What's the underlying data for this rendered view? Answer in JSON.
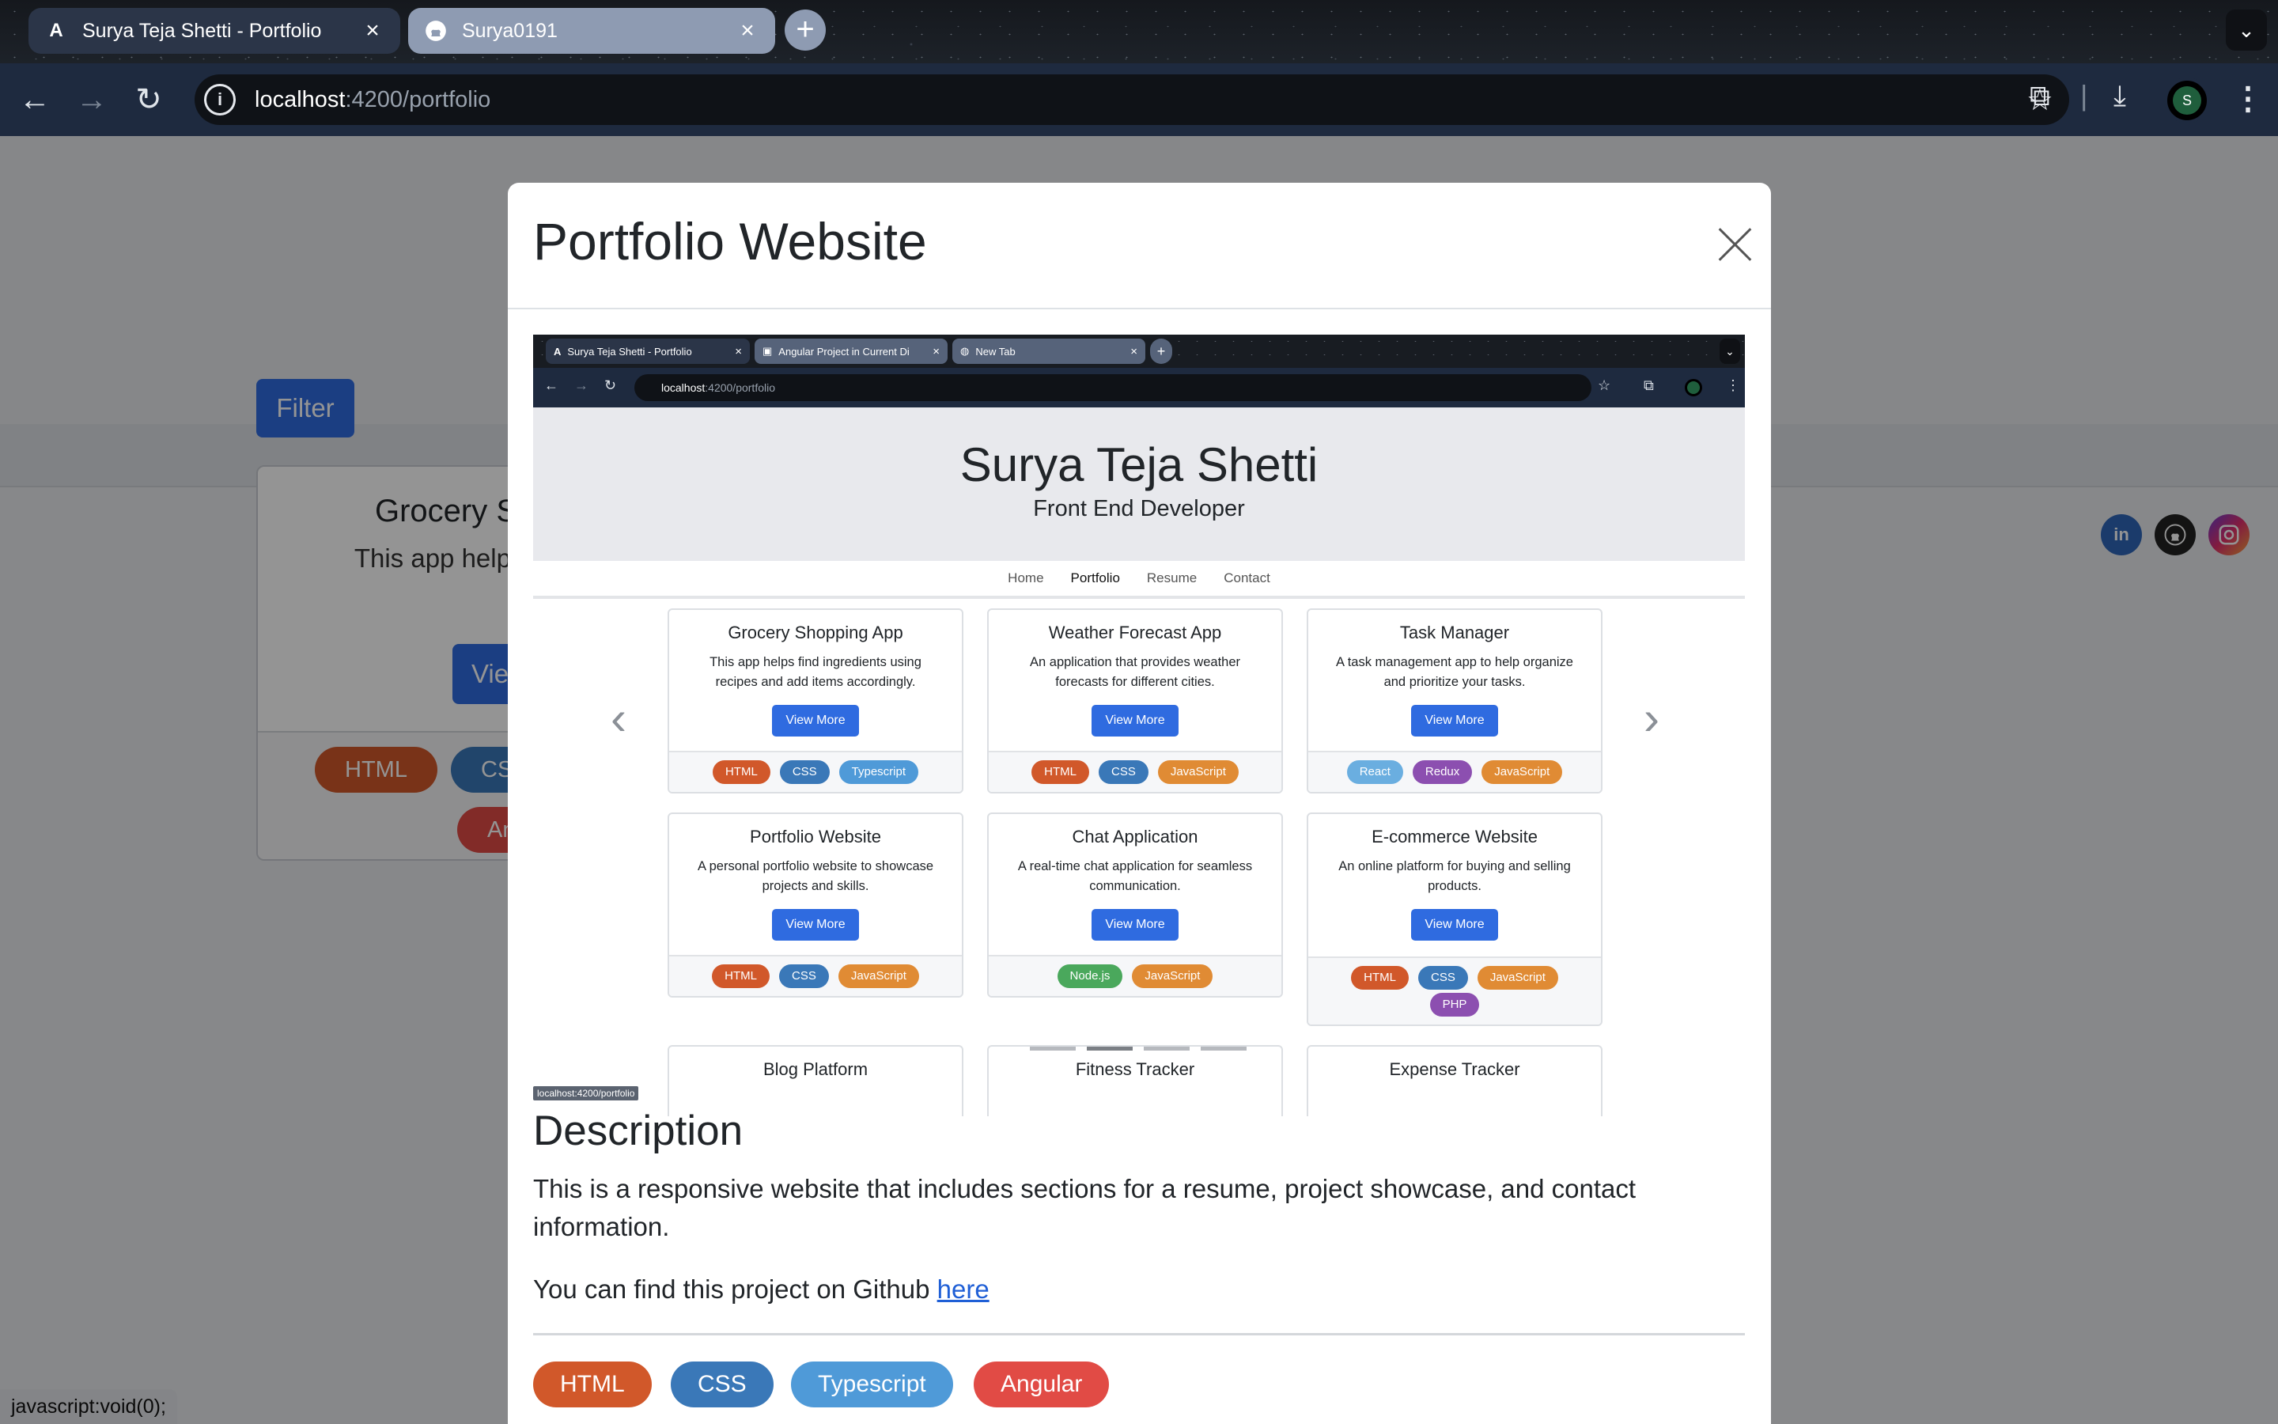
{
  "browser": {
    "tabs": [
      {
        "title": "Surya Teja Shetti - Portfolio",
        "icon": "angular-icon",
        "active": true
      },
      {
        "title": "Surya0191",
        "icon": "github-icon",
        "active": false
      }
    ],
    "new_tab": "+",
    "url_host": "localhost",
    "url_path": ":4200/portfolio",
    "status_bar": "javascript:void(0);",
    "avatar_letter": "S"
  },
  "page": {
    "filter_label": "Filter",
    "card": {
      "title": "Grocery S",
      "text": "This app helps fi recipes and add",
      "button": "Vie",
      "tags": [
        "HTML",
        "CS",
        "An"
      ]
    },
    "socials": [
      "linkedin-icon",
      "github-icon",
      "instagram-icon"
    ],
    "social_labels": {
      "linkedin": "in"
    }
  },
  "modal": {
    "title": "Portfolio Website",
    "screenshot": {
      "tabs": [
        "Surya Teja Shetti - Portfolio",
        "Angular Project in Current Di",
        "New Tab"
      ],
      "url_host": "localhost",
      "url_path": ":4200/portfolio",
      "hero_name": "Surya Teja Shetti",
      "hero_role": "Front End Developer",
      "nav": [
        "Home",
        "Portfolio",
        "Resume",
        "Contact"
      ],
      "view_more": "View More",
      "projects": [
        {
          "title": "Grocery Shopping App",
          "desc": "This app helps find ingredients using recipes and add items accordingly.",
          "tags": [
            "HTML",
            "CSS",
            "Typescript"
          ]
        },
        {
          "title": "Weather Forecast App",
          "desc": "An application that provides weather forecasts for different cities.",
          "tags": [
            "HTML",
            "CSS",
            "JavaScript"
          ]
        },
        {
          "title": "Task Manager",
          "desc": "A task management app to help organize and prioritize your tasks.",
          "tags": [
            "React",
            "Redux",
            "JavaScript"
          ]
        },
        {
          "title": "Portfolio Website",
          "desc": "A personal portfolio website to showcase projects and skills.",
          "tags": [
            "HTML",
            "CSS",
            "JavaScript"
          ]
        },
        {
          "title": "Chat Application",
          "desc": "A real-time chat application for seamless communication.",
          "tags": [
            "Node.js",
            "JavaScript"
          ]
        },
        {
          "title": "E-commerce Website",
          "desc": "An online platform for buying and selling products.",
          "tags": [
            "HTML",
            "CSS",
            "JavaScript",
            "PHP"
          ]
        },
        {
          "title": "Blog Platform"
        },
        {
          "title": "Fitness Tracker"
        },
        {
          "title": "Expense Tracker"
        }
      ],
      "status": "localhost:4200/portfolio"
    },
    "description_heading": "Description",
    "description": "This is a responsive website that includes sections for a resume, project showcase, and contact information.",
    "github_text": "You can find this project on Github ",
    "github_link": "here",
    "tags": [
      "HTML",
      "CSS",
      "Typescript",
      "Angular"
    ]
  },
  "colors": {
    "HTML": "#d1582a",
    "CSS": "#3a78b8",
    "Typescript": "#4f9ad8",
    "JavaScript": "#e08b34",
    "Angular": "#e14b45",
    "React": "#6aaee0",
    "Redux": "#8c4fb0",
    "Node.js": "#4aa85c",
    "PHP": "#8c4fb0",
    "primary": "#2f6be0"
  }
}
